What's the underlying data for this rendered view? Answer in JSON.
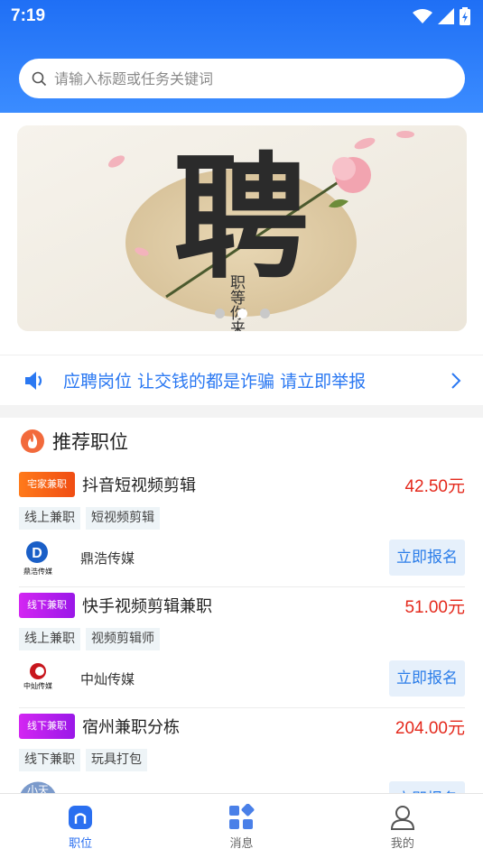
{
  "status": {
    "time": "7:19"
  },
  "search": {
    "placeholder": "请输入标题或任务关键词"
  },
  "banner": {
    "big_char": "聘",
    "small_text": "职等你来"
  },
  "notice": {
    "text": "应聘岗位 让交钱的都是诈骗 请立即举报"
  },
  "section": {
    "title": "推荐职位"
  },
  "jobs": [
    {
      "tag": "宅家兼职",
      "title": "抖音短视频剪辑",
      "salary": "42.50元",
      "chips": [
        "线上兼职",
        "短视频剪辑"
      ],
      "company": "鼎浩传媒",
      "apply": "立即报名",
      "logo_text": "鼎浩传媒"
    },
    {
      "tag": "线下兼职",
      "title": "快手视频剪辑兼职",
      "salary": "51.00元",
      "chips": [
        "线上兼职",
        "视频剪辑师"
      ],
      "company": "中灿传媒",
      "apply": "立即报名",
      "logo_text": "中灿传媒"
    },
    {
      "tag": "线下兼职",
      "title": "宿州兼职分栋",
      "salary": "204.00元",
      "chips": [
        "线下兼职",
        "玩具打包"
      ],
      "company": "",
      "apply": "立即报名",
      "logo_text": "小天"
    }
  ],
  "tabs": [
    {
      "label": "职位",
      "icon": "home-icon"
    },
    {
      "label": "消息",
      "icon": "grid-icon"
    },
    {
      "label": "我的",
      "icon": "user-icon"
    }
  ],
  "colors": {
    "primary": "#2a6ff0",
    "salary": "#e4291c",
    "notice": "#2a78f2"
  }
}
